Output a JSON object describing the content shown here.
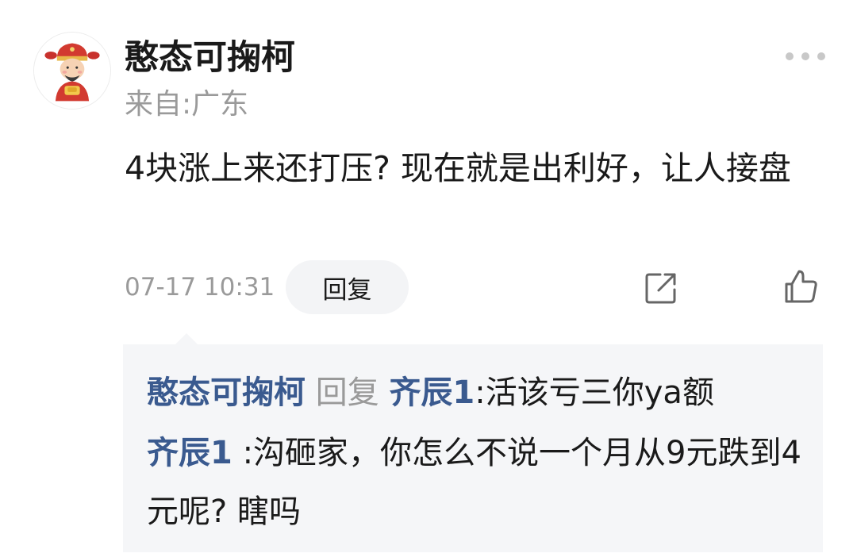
{
  "comment": {
    "username": "憨态可掬柯",
    "location": "来自:广东",
    "text": "4块涨上来还打压? 现在就是出利好，让人接盘",
    "timestamp": "07-17 10:31",
    "reply_button_label": "回复",
    "avatar_icon": "caishen-avatar",
    "more_icon": "more-dots-icon",
    "share_icon": "share-icon",
    "like_icon": "thumbs-up-icon"
  },
  "replies": [
    {
      "author": "憨态可掬柯",
      "reply_word": "回复",
      "target": "齐辰1",
      "separator": ":",
      "text": "活该亏三你ya额"
    },
    {
      "author": "齐辰1",
      "separator": ":",
      "text": "沟砸家，你怎么不说一个月从9元跌到4元呢? 瞎吗"
    }
  ],
  "colors": {
    "name_link": "#3a5a8f",
    "muted_text": "#9a9a9a",
    "reply_background": "#f5f6f8",
    "reply_button_background": "#f3f4f6"
  }
}
